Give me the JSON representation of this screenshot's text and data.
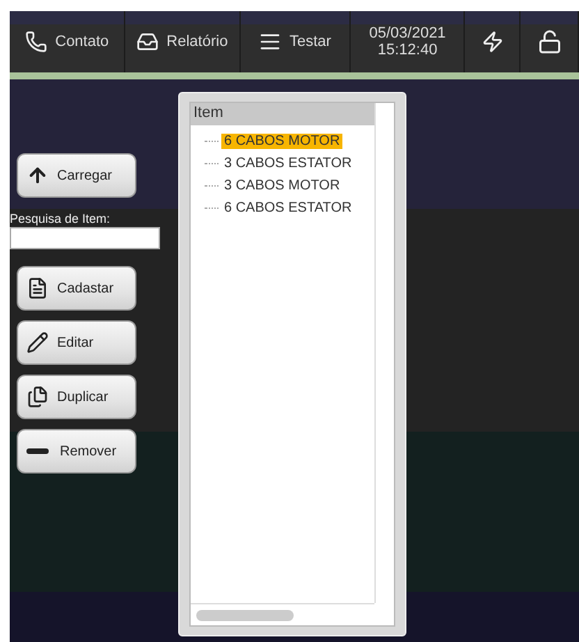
{
  "toolbar": [
    {
      "kind": "button",
      "label": "Contato"
    },
    {
      "kind": "button",
      "label": "Relatório"
    },
    {
      "kind": "button",
      "label": "Testar"
    },
    {
      "kind": "clock",
      "date": "05/03/2021",
      "time": "15:12:40"
    },
    {
      "kind": "icon"
    },
    {
      "kind": "icon"
    }
  ],
  "actions_top": [
    {
      "label": "Carregar"
    }
  ],
  "search": {
    "label": "Pesquisa de Item:"
  },
  "actions": [
    {
      "label": "Cadastar"
    },
    {
      "label": "Editar"
    },
    {
      "label": "Duplicar"
    },
    {
      "label": "Remover"
    }
  ],
  "tree": {
    "header": "Item",
    "items": [
      {
        "label": "6 CABOS MOTOR",
        "selected": true
      },
      {
        "label": "3 CABOS ESTATOR",
        "selected": false
      },
      {
        "label": "3 CABOS MOTOR",
        "selected": false
      },
      {
        "label": "6 CABOS ESTATOR",
        "selected": false
      }
    ]
  }
}
